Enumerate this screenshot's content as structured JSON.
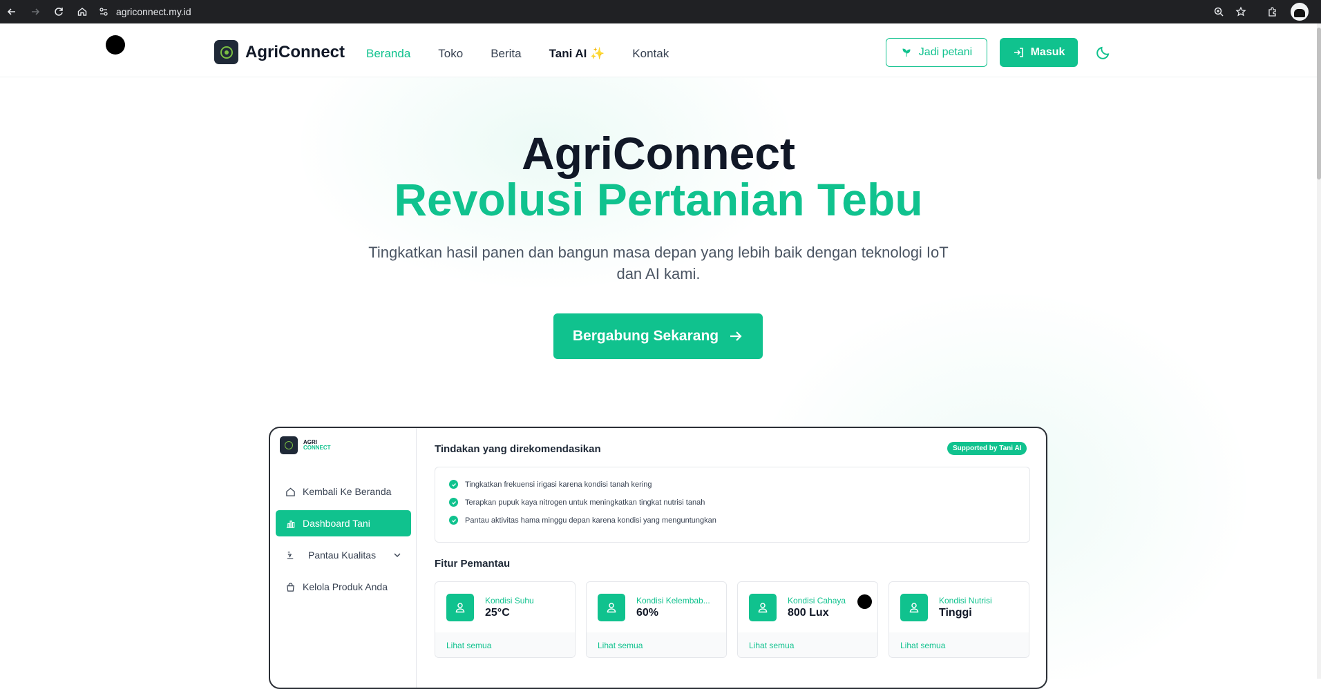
{
  "browser": {
    "url": "agriconnect.my.id"
  },
  "header": {
    "brand": "AgriConnect",
    "nav": [
      {
        "label": "Beranda"
      },
      {
        "label": "Toko"
      },
      {
        "label": "Berita"
      },
      {
        "label": "Tani AI ✨"
      },
      {
        "label": "Kontak"
      }
    ],
    "farmer_button": "Jadi petani",
    "login_button": "Masuk"
  },
  "hero": {
    "title": "AgriConnect",
    "title_accent": "Revolusi Pertanian Tebu",
    "subtitle": "Tingkatkan hasil panen dan bangun masa depan yang lebih baik dengan teknologi IoT dan AI kami.",
    "cta": "Bergabung Sekarang"
  },
  "dashboard": {
    "logo_top": "AGRI",
    "logo_bottom": "CONNECT",
    "sidebar": [
      {
        "label": "Kembali Ke Beranda"
      },
      {
        "label": "Dashboard Tani"
      },
      {
        "label": "Pantau Kualitas"
      },
      {
        "label": "Kelola Produk Anda"
      }
    ],
    "recommendations_title": "Tindakan yang direkomendasikan",
    "badge": "Supported by Tani AI",
    "recommendations": [
      "Tingkatkan frekuensi irigasi karena kondisi tanah kering",
      "Terapkan pupuk kaya nitrogen untuk meningkatkan tingkat nutrisi tanah",
      "Pantau aktivitas hama minggu depan karena kondisi yang menguntungkan"
    ],
    "features_title": "Fitur Pemantau",
    "cards": [
      {
        "label": "Kondisi Suhu",
        "value": "25°C",
        "link": "Lihat semua"
      },
      {
        "label": "Kondisi Kelembab...",
        "value": "60%",
        "link": "Lihat semua"
      },
      {
        "label": "Kondisi Cahaya",
        "value": "800 Lux",
        "link": "Lihat semua"
      },
      {
        "label": "Kondisi Nutrisi",
        "value": "Tinggi",
        "link": "Lihat semua"
      }
    ]
  },
  "colors": {
    "accent": "#10c28e",
    "dark": "#111827"
  }
}
